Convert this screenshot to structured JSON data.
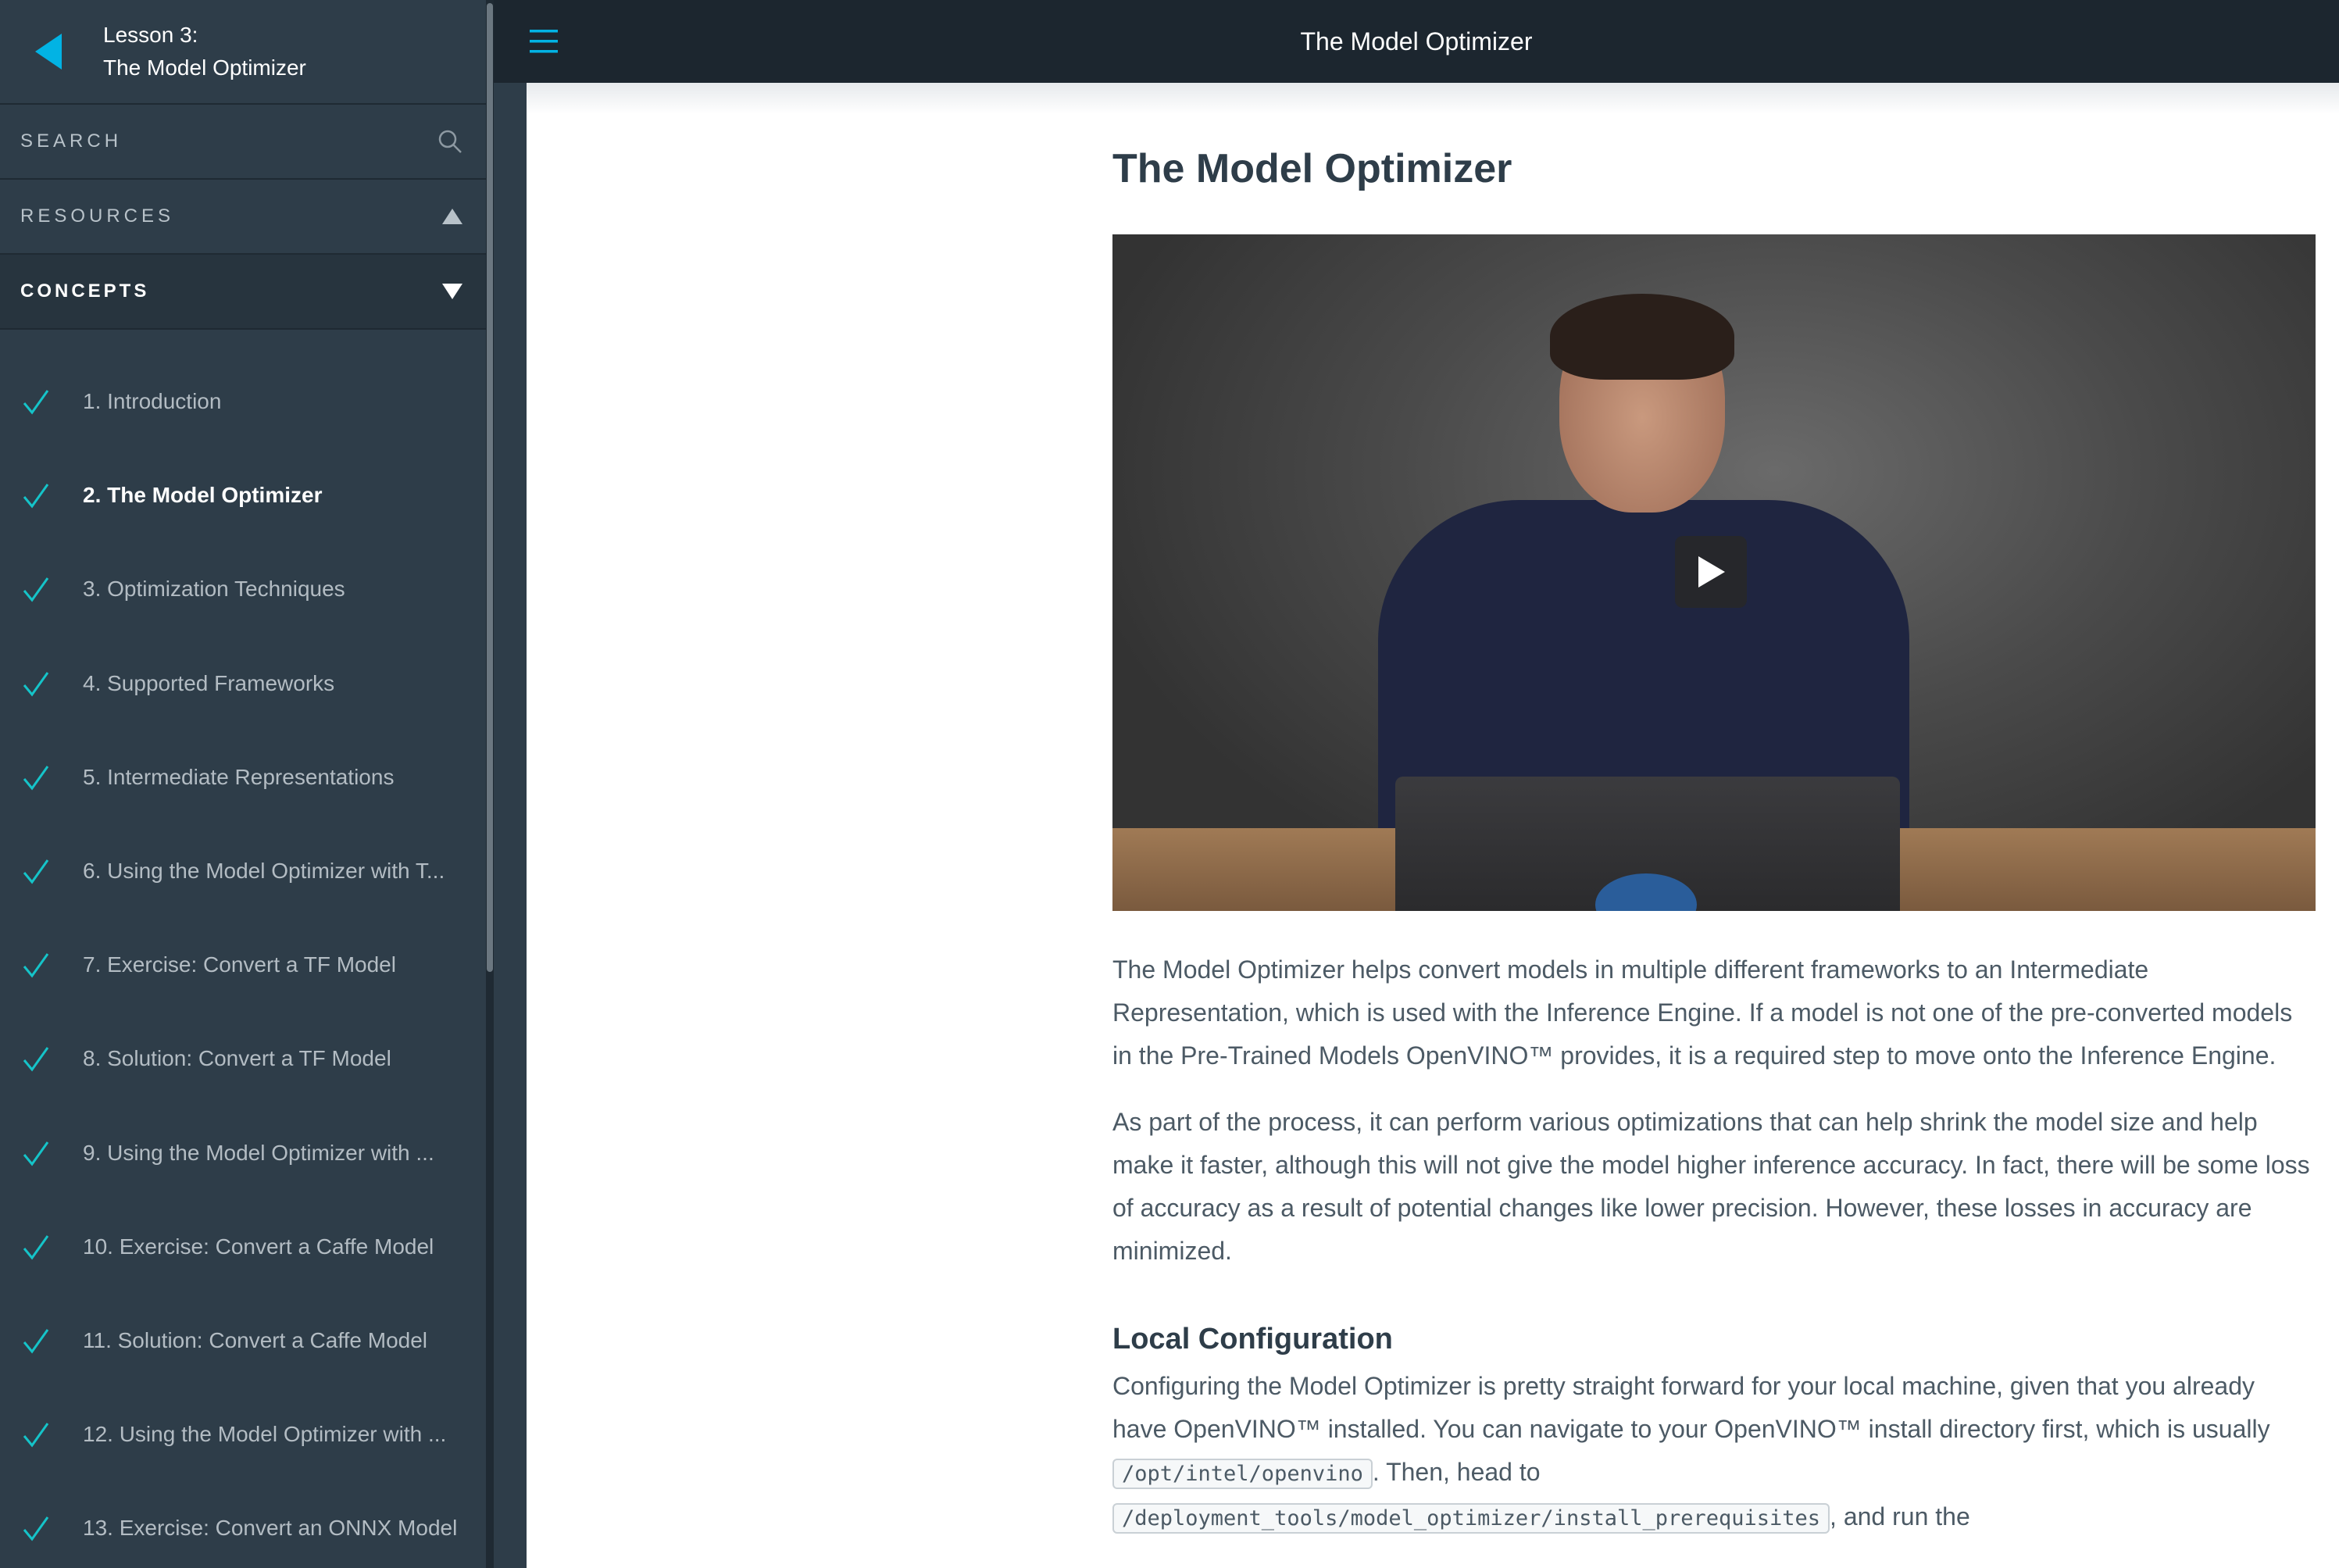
{
  "sidebar": {
    "lesson_label": "Lesson 3:",
    "lesson_name": "The Model Optimizer",
    "search_label": "SEARCH",
    "resources_label": "RESOURCES",
    "concepts_label": "CONCEPTS",
    "concepts": [
      {
        "label": "1. Introduction",
        "done": true
      },
      {
        "label": "2. The Model Optimizer",
        "done": true,
        "active": true
      },
      {
        "label": "3. Optimization Techniques",
        "done": true
      },
      {
        "label": "4. Supported Frameworks",
        "done": true
      },
      {
        "label": "5. Intermediate Representations",
        "done": true
      },
      {
        "label": "6. Using the Model Optimizer with T...",
        "done": true
      },
      {
        "label": "7. Exercise: Convert a TF Model",
        "done": true
      },
      {
        "label": "8. Solution: Convert a TF Model",
        "done": true
      },
      {
        "label": "9. Using the Model Optimizer with ...",
        "done": true
      },
      {
        "label": "10. Exercise: Convert a Caffe Model",
        "done": true
      },
      {
        "label": "11. Solution: Convert a Caffe Model",
        "done": true
      },
      {
        "label": "12. Using the Model Optimizer with ...",
        "done": true
      },
      {
        "label": "13. Exercise: Convert an ONNX Model",
        "done": true
      }
    ]
  },
  "topbar": {
    "title": "The Model Optimizer"
  },
  "main": {
    "title": "The Model Optimizer",
    "para1": "The Model Optimizer helps convert models in multiple different frameworks to an Intermediate Representation, which is used with the Inference Engine. If a model is not one of the pre-converted models in the Pre-Trained Models OpenVINO™ provides, it is a required step to move onto the Inference Engine.",
    "para2": "As part of the process, it can perform various optimizations that can help shrink the model size and help make it faster, although this will not give the model higher inference accuracy. In fact, there will be some loss of accuracy as a result of potential changes like lower precision. However, these losses in accuracy are minimized.",
    "section_title": "Local Configuration",
    "para3_a": "Configuring the Model Optimizer is pretty straight forward for your local machine, given that you already have OpenVINO™ installed. You can navigate to your OpenVINO™ install directory first, which is usually ",
    "para3_code1": "/opt/intel/openvino",
    "para3_b": ". Then, head to ",
    "para3_code2": "/deployment_tools/model_optimizer/install_prerequisites",
    "para3_c": ", and run the"
  },
  "colors": {
    "sidebar_bg": "#2e3d49",
    "topbar_bg": "#1c262f",
    "accent": "#02b3e4",
    "check": "#15c4c9"
  }
}
